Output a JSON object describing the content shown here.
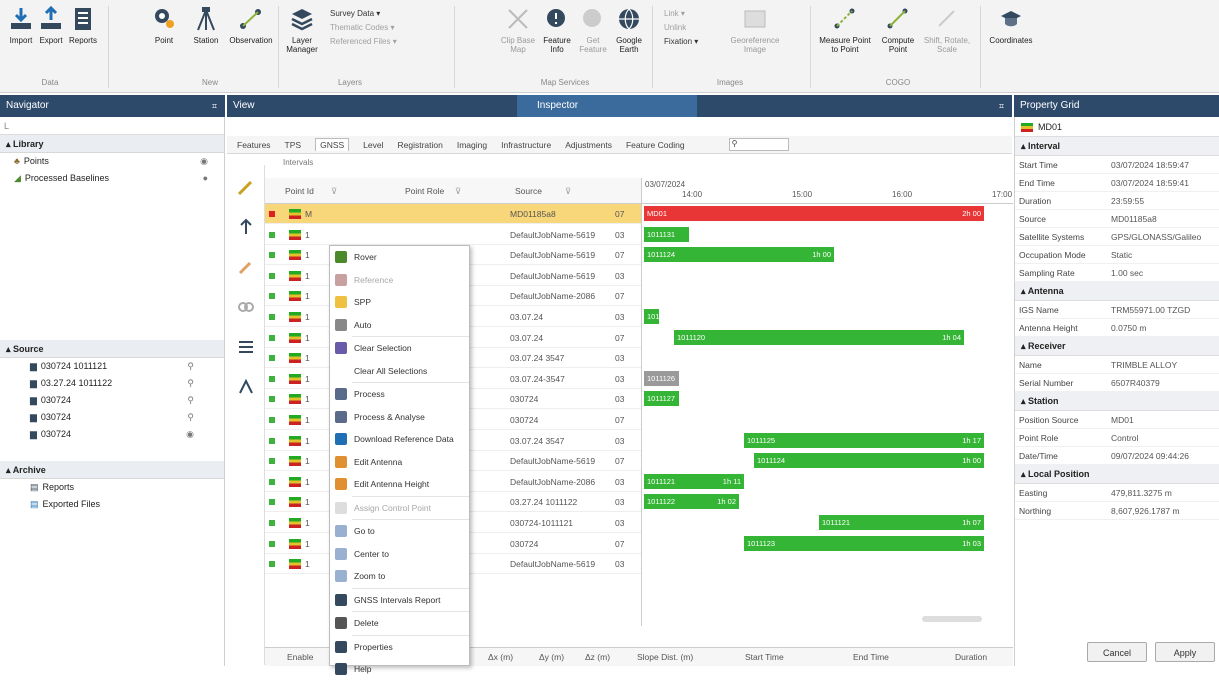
{
  "ribbon": {
    "buttons": [
      {
        "name": "import-button",
        "label": "Import"
      },
      {
        "name": "export-button",
        "label": "Export"
      },
      {
        "name": "reports-button",
        "label": "Reports"
      },
      {
        "name": "point-button",
        "label": "Point"
      },
      {
        "name": "station-button",
        "label": "Station"
      },
      {
        "name": "observation-button",
        "label": "Observation"
      },
      {
        "name": "layer-manager-button",
        "label": "Layer Manager"
      },
      {
        "name": "clip-base-map-button",
        "label": "Clip Base Map"
      },
      {
        "name": "feature-info-button",
        "label": "Feature Info"
      },
      {
        "name": "get-feature-button",
        "label": "Get Feature"
      },
      {
        "name": "google-earth-button",
        "label": "Google Earth"
      },
      {
        "name": "georeference-image-button",
        "label": "Georeference Image"
      },
      {
        "name": "measure-point-to-point-button",
        "label": "Measure Point to Point"
      },
      {
        "name": "compute-point-button",
        "label": "Compute Point"
      },
      {
        "name": "shift-rotate-scale-button",
        "label": "Shift, Rotate, Scale"
      },
      {
        "name": "coordinates-button",
        "label": "Coordinates"
      }
    ],
    "groups": [
      "Data",
      "New",
      "Layers",
      "Map Services",
      "Images",
      "COGO"
    ],
    "layers_menu": [
      "Survey Data",
      "Thematic Codes",
      "Referenced Files"
    ],
    "images_menu": [
      "Link",
      "Unlink",
      "Fixation"
    ]
  },
  "navigator": {
    "title": "Navigator",
    "search_value": "L",
    "library_label": "Library",
    "library_items": [
      "Points",
      "Processed Baselines"
    ],
    "source_label": "Source",
    "source_items": [
      "030724 1011121",
      "03.27.24 1011122",
      "030724",
      "030724",
      "030724"
    ],
    "archive_label": "Archive",
    "archive_items": [
      "Reports",
      "Exported Files"
    ]
  },
  "view": {
    "title": "View"
  },
  "inspector": {
    "title": "Inspector"
  },
  "tabs": [
    "Features",
    "TPS",
    "GNSS",
    "Level",
    "Registration",
    "Imaging",
    "Infrastructure",
    "Adjustments",
    "Feature Coding"
  ],
  "breadcrumb": "Intervals",
  "grid": {
    "columns": [
      "Point Id",
      "Point Role",
      "Source"
    ],
    "rows": [
      {
        "id": "M",
        "source": "MD01185a8",
        "c": "07"
      },
      {
        "id": "1",
        "source": "DefaultJobName-5619",
        "c": "03"
      },
      {
        "id": "1",
        "source": "DefaultJobName-5619",
        "c": "07"
      },
      {
        "id": "1",
        "source": "DefaultJobName-5619",
        "c": "03"
      },
      {
        "id": "1",
        "source": "DefaultJobName-2086",
        "c": "07"
      },
      {
        "id": "1",
        "source": "03.07.24",
        "c": "03"
      },
      {
        "id": "1",
        "source": "03.07.24",
        "c": "07"
      },
      {
        "id": "1",
        "source": "03.07.24 3547",
        "c": "03"
      },
      {
        "id": "1",
        "source": "03.07.24-3547",
        "c": "03"
      },
      {
        "id": "1",
        "source": "030724",
        "c": "03"
      },
      {
        "id": "1",
        "source": "030724",
        "c": "07"
      },
      {
        "id": "1",
        "source": "03.07.24 3547",
        "c": "03"
      },
      {
        "id": "1",
        "source": "DefaultJobName-5619",
        "c": "07"
      },
      {
        "id": "1",
        "source": "DefaultJobName-2086",
        "c": "03"
      },
      {
        "id": "1",
        "source": "03.27.24 1011122",
        "c": "03"
      },
      {
        "id": "1",
        "source": "030724-1011121",
        "c": "03"
      },
      {
        "id": "1",
        "source": "030724",
        "c": "07"
      },
      {
        "id": "1",
        "source": "DefaultJobName-5619",
        "c": "03"
      }
    ]
  },
  "timeline": {
    "date": "03/07/2024",
    "hours": [
      "14:00",
      "15:00",
      "16:00",
      "17:00"
    ],
    "bars": [
      {
        "label": "MD01",
        "end": "2h 00",
        "color": "red"
      },
      {
        "label": "1011131",
        "end": "",
        "color": "green"
      },
      {
        "label": "1011124",
        "end": "1h 00",
        "color": "green"
      },
      {
        "label": "",
        "end": "",
        "color": "none"
      },
      {
        "label": "",
        "end": "",
        "color": "none"
      },
      {
        "label": "101",
        "end": "",
        "color": "green"
      },
      {
        "label": "1011120",
        "end": "1h 04",
        "color": "green"
      },
      {
        "label": "",
        "end": "",
        "color": "none"
      },
      {
        "label": "1011126",
        "end": "",
        "color": "grey"
      },
      {
        "label": "1011127",
        "end": "",
        "color": "green"
      },
      {
        "label": "",
        "end": "",
        "color": "none"
      },
      {
        "label": "1011125",
        "end": "1h 17",
        "color": "green"
      },
      {
        "label": "1011124",
        "end": "1h 00",
        "color": "green"
      },
      {
        "label": "1011121",
        "end": "1h 11",
        "color": "green"
      },
      {
        "label": "1011122",
        "end": "1h 02",
        "color": "green"
      },
      {
        "label": "1011121",
        "end": "1h 07",
        "color": "green"
      },
      {
        "label": "1011123",
        "end": "1h 03",
        "color": "green"
      },
      {
        "label": "",
        "end": "",
        "color": "none"
      }
    ]
  },
  "context_menu": [
    {
      "name": "rover",
      "label": "Rover",
      "dim": false
    },
    {
      "name": "reference",
      "label": "Reference",
      "dim": true
    },
    {
      "name": "spp",
      "label": "SPP",
      "dim": false
    },
    {
      "name": "auto",
      "label": "Auto",
      "dim": false
    },
    {
      "name": "clear-selection",
      "label": "Clear Selection",
      "dim": false
    },
    {
      "name": "clear-all-selections",
      "label": "Clear All Selections",
      "dim": false
    },
    {
      "name": "process",
      "label": "Process",
      "dim": false
    },
    {
      "name": "process-analyse",
      "label": "Process & Analyse",
      "dim": false
    },
    {
      "name": "download-reference-data",
      "label": "Download Reference Data",
      "dim": false
    },
    {
      "name": "edit-antenna",
      "label": "Edit Antenna",
      "dim": false
    },
    {
      "name": "edit-antenna-height",
      "label": "Edit Antenna Height",
      "dim": false
    },
    {
      "name": "assign-control-point",
      "label": "Assign Control Point",
      "dim": true
    },
    {
      "name": "go-to",
      "label": "Go to",
      "dim": false
    },
    {
      "name": "center-to",
      "label": "Center to",
      "dim": false
    },
    {
      "name": "zoom-to",
      "label": "Zoom to",
      "dim": false
    },
    {
      "name": "gnss-intervals-report",
      "label": "GNSS Intervals Report",
      "dim": false
    },
    {
      "name": "delete",
      "label": "Delete",
      "dim": false
    },
    {
      "name": "properties",
      "label": "Properties",
      "dim": false
    },
    {
      "name": "help",
      "label": "Help",
      "dim": false
    }
  ],
  "bottom_columns": [
    "Enable",
    "Δx (m)",
    "Δy (m)",
    "Δz (m)",
    "Slope Dist. (m)",
    "Start Time",
    "End Time",
    "Duration"
  ],
  "property_grid": {
    "title": "Property Grid",
    "selected": "MD01",
    "interval_label": "Interval",
    "interval": [
      {
        "k": "Start Time",
        "v": "03/07/2024 18:59:47"
      },
      {
        "k": "End Time",
        "v": "03/07/2024 18:59:41"
      },
      {
        "k": "Duration",
        "v": "23:59:55"
      },
      {
        "k": "Source",
        "v": "MD01185a8"
      },
      {
        "k": "Satellite Systems",
        "v": "GPS/GLONASS/Galileo"
      },
      {
        "k": "Occupation Mode",
        "v": "Static"
      },
      {
        "k": "Sampling Rate",
        "v": "1.00 sec"
      }
    ],
    "antenna_label": "Antenna",
    "antenna": [
      {
        "k": "IGS Name",
        "v": "TRM55971.00 TZGD"
      },
      {
        "k": "Antenna Height",
        "v": "0.0750 m"
      }
    ],
    "receiver_label": "Receiver",
    "receiver": [
      {
        "k": "Name",
        "v": "TRIMBLE ALLOY"
      },
      {
        "k": "Serial Number",
        "v": "6507R40379"
      }
    ],
    "station_label": "Station",
    "station": [
      {
        "k": "Position Source",
        "v": "MD01"
      },
      {
        "k": "Point Role",
        "v": "Control"
      },
      {
        "k": "Date/Time",
        "v": "09/07/2024 09:44:26"
      }
    ],
    "local_label": "Local Position",
    "local": [
      {
        "k": "Easting",
        "v": "479,811.3275 m"
      },
      {
        "k": "Northing",
        "v": "8,607,926.1787 m"
      }
    ],
    "cancel": "Cancel",
    "apply": "Apply"
  }
}
